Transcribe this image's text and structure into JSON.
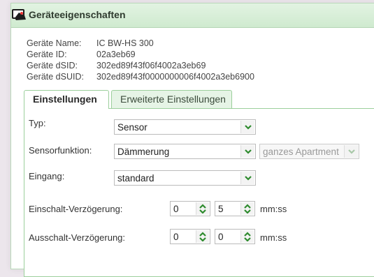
{
  "window": {
    "title": "Geräteeigenschaften",
    "close": "x"
  },
  "info": {
    "rows": [
      {
        "label": "Geräte Name:",
        "value": "IC BW-HS 300"
      },
      {
        "label": "Geräte ID:",
        "value": "02a3eb69"
      },
      {
        "label": "Geräte dSID:",
        "value": "302ed89f43f06f4002a3eb69"
      },
      {
        "label": "Geräte dSUID:",
        "value": "302ed89f43f0000000006f4002a3eb6900"
      }
    ]
  },
  "tabs": [
    {
      "label": "Einstellungen",
      "active": true
    },
    {
      "label": "Erweiterte Einstellungen",
      "active": false
    }
  ],
  "form": {
    "typ": {
      "label": "Typ:",
      "value": "Sensor"
    },
    "sensorfunktion": {
      "label": "Sensorfunktion:",
      "value": "Dämmerung",
      "scope": "ganzes Apartment"
    },
    "eingang": {
      "label": "Eingang:",
      "value": "standard"
    },
    "einschalt": {
      "label": "Einschalt-Verzögerung:",
      "v1": "0",
      "v2": "5",
      "unit": "mm:ss"
    },
    "ausschalt": {
      "label": "Ausschalt-Verzögerung:",
      "v1": "0",
      "v2": "0",
      "unit": "mm:ss"
    }
  },
  "colors": {
    "accent": "#3a9a3a",
    "title_bg": "#d8efd8",
    "tab_border": "#9ccf9c"
  },
  "icons": {
    "title": "device-properties-icon",
    "dropdown": "chevron-down-icon",
    "spinner": "spinner-arrows-icon"
  }
}
